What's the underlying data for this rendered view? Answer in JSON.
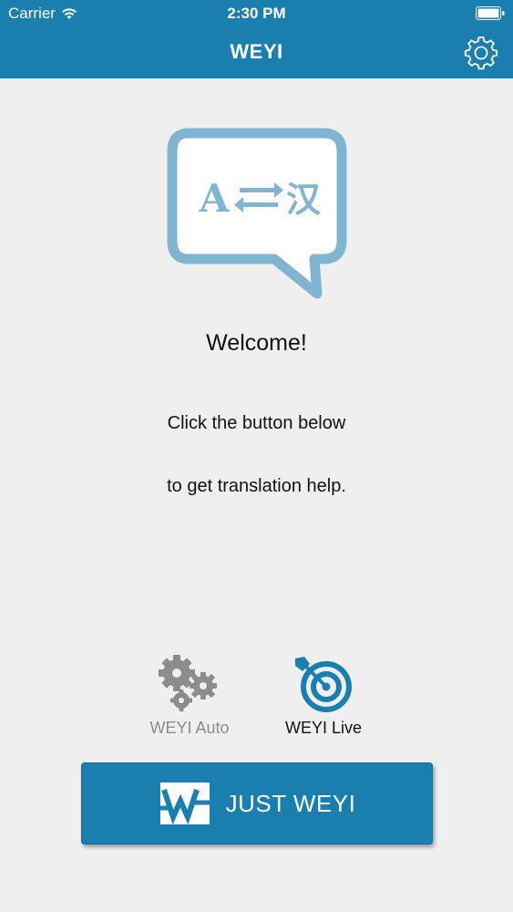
{
  "status_bar": {
    "carrier": "Carrier",
    "time": "2:30 PM"
  },
  "header": {
    "title": "WEYI"
  },
  "logo": {
    "left_glyph": "A",
    "right_glyph": "汉"
  },
  "welcome": "Welcome!",
  "instructions": {
    "line1": "Click the button below",
    "line2": "to get translation help."
  },
  "modes": [
    {
      "label": "WEYI Auto",
      "icon": "gears-icon",
      "active": false
    },
    {
      "label": "WEYI Live",
      "icon": "target-icon",
      "active": true
    }
  ],
  "main_button": {
    "label": "JUST WEYI",
    "icon": "weyi-logo-icon"
  },
  "colors": {
    "primary": "#1a7faf",
    "background": "#efeff0",
    "logo_blue": "#7fb5d1",
    "inactive_gray": "#8c8c8c"
  }
}
